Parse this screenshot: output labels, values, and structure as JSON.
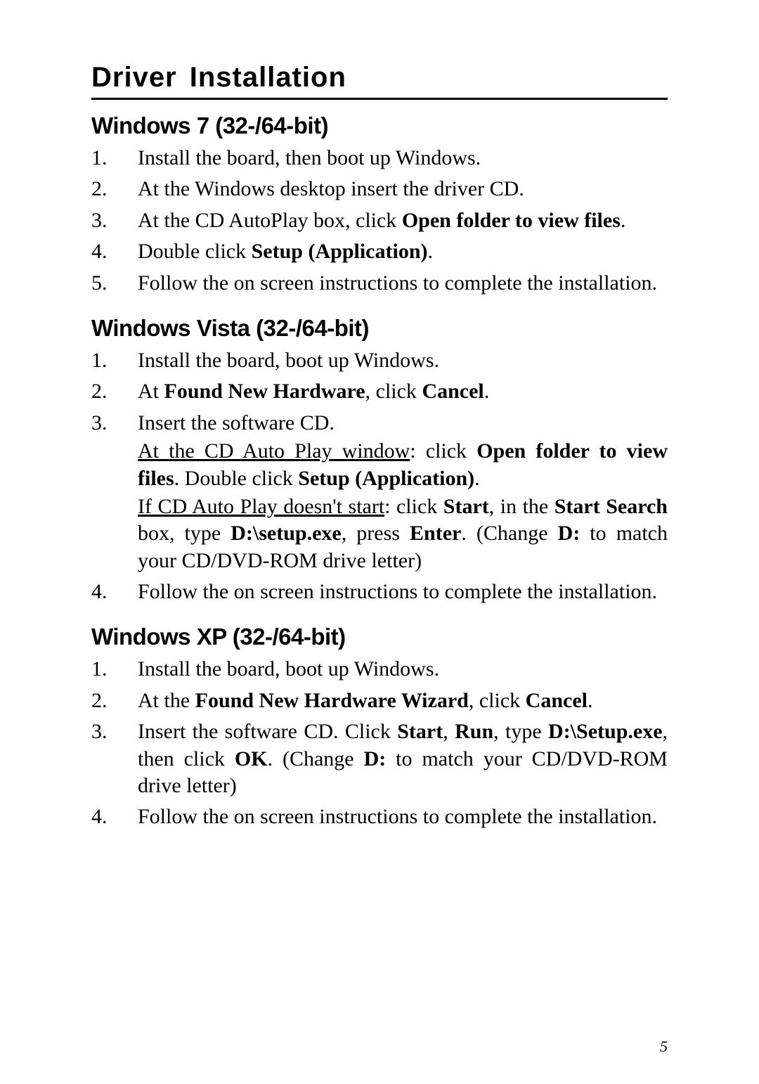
{
  "title": "Driver  Installation",
  "page_number": "5",
  "sections": [
    {
      "heading": "Windows 7 (32-/64-bit)",
      "steps": [
        [
          {
            "t": "Install the board, then boot up Windows."
          }
        ],
        [
          {
            "t": "At the Windows desktop insert the driver CD."
          }
        ],
        [
          {
            "t": "At the CD AutoPlay box, click "
          },
          {
            "t": "Open folder to view files",
            "b": true
          },
          {
            "t": "."
          }
        ],
        [
          {
            "t": "Double click "
          },
          {
            "t": "Setup (Application)",
            "b": true
          },
          {
            "t": "."
          }
        ],
        [
          {
            "t": "Follow the on screen instructions to complete the installation."
          }
        ]
      ]
    },
    {
      "heading": "Windows Vista (32-/64-bit)",
      "steps": [
        [
          {
            "t": "Install the board, boot up Windows."
          }
        ],
        [
          {
            "t": "At "
          },
          {
            "t": "Found New Hardware",
            "b": true
          },
          {
            "t": ", click "
          },
          {
            "t": "Cancel",
            "b": true
          },
          {
            "t": "."
          }
        ],
        [
          {
            "t": "Insert the software CD."
          },
          {
            "br": true
          },
          {
            "t": "At the CD Auto Play window",
            "u": true
          },
          {
            "t": ": click "
          },
          {
            "t": "Open folder to view files",
            "b": true
          },
          {
            "t": ".  Double click "
          },
          {
            "t": "Setup (Application)",
            "b": true
          },
          {
            "t": "."
          },
          {
            "br": true
          },
          {
            "t": "If CD Auto Play doesn't start",
            "u": true
          },
          {
            "t": ": click "
          },
          {
            "t": "Start",
            "b": true
          },
          {
            "t": ", in the "
          },
          {
            "t": "Start Search",
            "b": true
          },
          {
            "t": " box, type "
          },
          {
            "t": "D:\\setup.exe",
            "b": true
          },
          {
            "t": ", press "
          },
          {
            "t": "Enter",
            "b": true
          },
          {
            "t": ". (Change "
          },
          {
            "t": "D:",
            "b": true
          },
          {
            "t": " to match your CD/DVD-ROM drive letter)"
          }
        ],
        [
          {
            "t": "Follow the on screen instructions to complete the installation."
          }
        ]
      ]
    },
    {
      "heading": "Windows XP (32-/64-bit)",
      "steps": [
        [
          {
            "t": "Install the board, boot up Windows."
          }
        ],
        [
          {
            "t": "At the "
          },
          {
            "t": "Found New Hardware Wizard",
            "b": true
          },
          {
            "t": ", click "
          },
          {
            "t": "Cancel",
            "b": true
          },
          {
            "t": "."
          }
        ],
        [
          {
            "t": "Insert the software CD.  Click "
          },
          {
            "t": "Start",
            "b": true
          },
          {
            "t": ", "
          },
          {
            "t": "Run",
            "b": true
          },
          {
            "t": ", type "
          },
          {
            "t": "D:\\Setup.exe",
            "b": true
          },
          {
            "t": ", then click "
          },
          {
            "t": "OK",
            "b": true
          },
          {
            "t": ". (Change "
          },
          {
            "t": "D:",
            "b": true
          },
          {
            "t": " to match your CD/DVD-ROM drive letter)"
          }
        ],
        [
          {
            "t": "Follow the on screen instructions to complete the installation."
          }
        ]
      ]
    }
  ]
}
